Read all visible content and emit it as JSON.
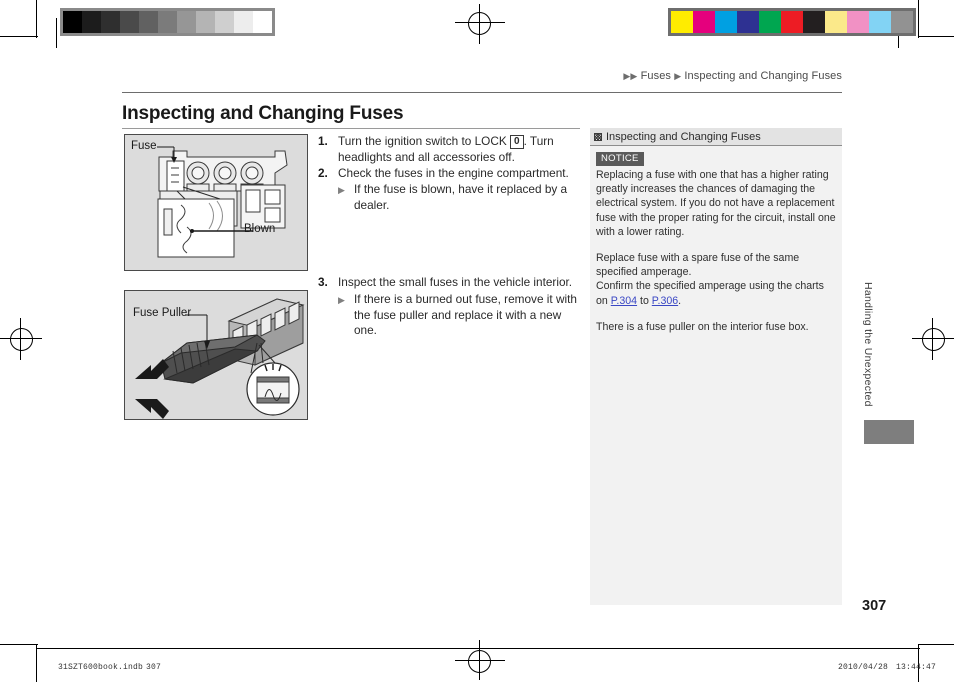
{
  "document": {
    "running_head": {
      "arrow_first": "▶▶",
      "crumb_1": "Fuses",
      "arrow_second": "▶",
      "crumb_2": "Inspecting and Changing Fuses"
    },
    "chapter_title": "Inspecting and Changing Fuses",
    "page_number": "307",
    "side_tab_label": "Handling the Unexpected"
  },
  "figures": {
    "fusebox": {
      "name": "engine-compartment-fuse-box",
      "label_fuse": "Fuse",
      "label_blown": "Blown"
    },
    "fusepuller": {
      "name": "fuse-puller-illustration",
      "label_puller": "Fuse Puller"
    }
  },
  "steps": [
    {
      "number": "1.",
      "text_before_key": "Turn the ignition switch to LOCK ",
      "key": "0",
      "text_after_key": ". Turn headlights and all accessories off.",
      "bullets": []
    },
    {
      "number": "2.",
      "text": "Check the fuses in the engine compartment.",
      "bullets": [
        "If the fuse is blown, have it replaced by a dealer."
      ]
    },
    {
      "number": "3.",
      "text": "Inspect the small fuses in the vehicle interior.",
      "bullets": [
        "If there is a burned out fuse, remove it with the fuse puller and replace it with a new one."
      ]
    }
  ],
  "notice_panel": {
    "header_title": "Inspecting and Changing Fuses",
    "badge": "NOTICE",
    "paragraph_1": "Replacing a fuse with one that has a higher rating greatly increases the chances of damaging the electrical system. If you do not have a replacement fuse with the proper rating for the circuit, install one with a lower rating.",
    "paragraph_2_line_1": "Replace fuse with a spare fuse of the same specified amperage.",
    "paragraph_2_line_2_pre": "Confirm the specified amperage using the charts on ",
    "paragraph_2_ref_1": "P.304",
    "paragraph_2_mid": " to ",
    "paragraph_2_ref_2": "P.306",
    "paragraph_2_post": ".",
    "paragraph_3": "There is a fuse puller on the interior fuse box."
  },
  "imposition_footer": {
    "file_name": "31SZT600book.indb",
    "page": "307",
    "date": "2010/04/28",
    "time": "13:44:47"
  },
  "calibration": {
    "grayscale_wedge": [
      "#000000",
      "#1c1c1c",
      "#2f2f2f",
      "#4a4a4a",
      "#616161",
      "#7b7b7b",
      "#969696",
      "#b4b4b4",
      "#cfcfcf",
      "#ededed",
      "#ffffff"
    ],
    "color_bar": [
      "#ffec00",
      "#e5007d",
      "#00a0e2",
      "#2e3192",
      "#00a650",
      "#ed1c24",
      "#231f20",
      "#fbe98a",
      "#f191c4",
      "#82d3f4",
      "#929292"
    ]
  }
}
